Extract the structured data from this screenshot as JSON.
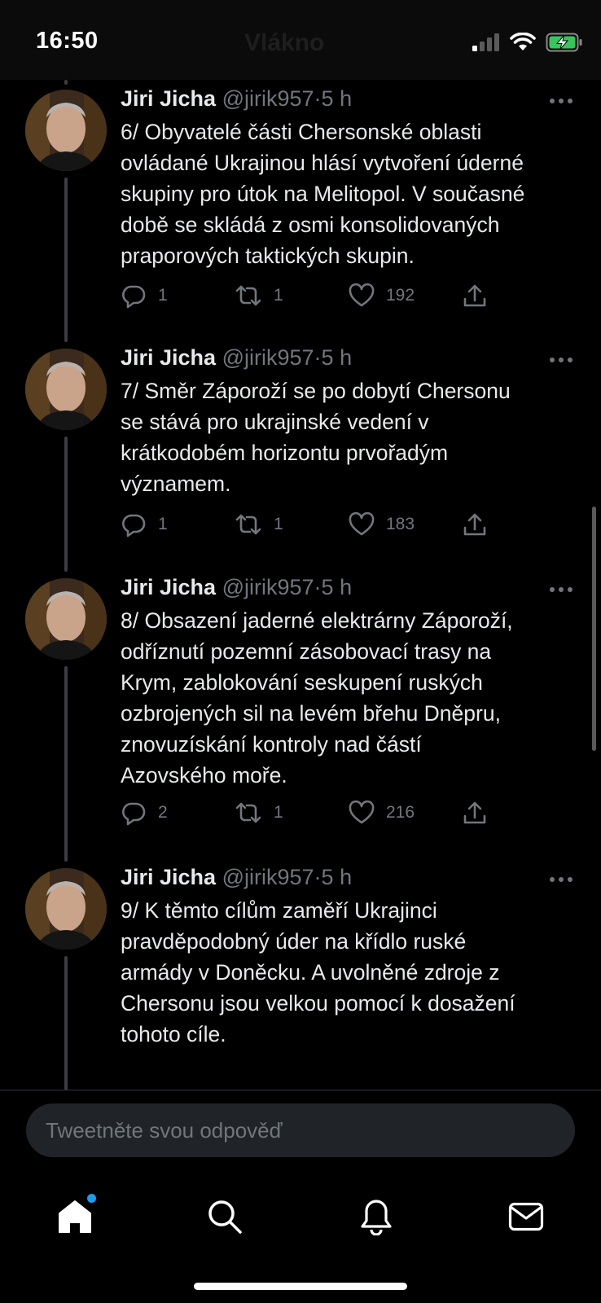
{
  "status": {
    "time": "16:50",
    "faded_title": "Vlákno"
  },
  "author": {
    "name": "Jiri Jicha",
    "handle": "@jirik957",
    "separator": "·"
  },
  "tweets": [
    {
      "time": "5 h",
      "text": "6/ Obyvatelé části Chersonské oblasti\novládané Ukrajinou hlásí vytvoření úderné\nskupiny pro útok na Melitopol. V současné\ndobě se skládá z osmi konsolidovaných\npraporových taktických skupin.",
      "replies": "1",
      "retweets": "1",
      "likes": "192"
    },
    {
      "time": "5 h",
      "text": "7/  Směr Záporoží se po dobytí Chersonu\nse stává pro ukrajinské vedení v\nkrátkodobém horizontu prvořadým\nvýznamem.",
      "replies": "1",
      "retweets": "1",
      "likes": "183"
    },
    {
      "time": "5 h",
      "text": "8/  Obsazení jaderné elektrárny Záporoží,\nodříznutí pozemní zásobovací trasy na\nKrym, zablokování seskupení ruských\nozbrojených sil na levém břehu Dněpru,\nznovuzískání kontroly nad částí\nAzovského moře.",
      "replies": "2",
      "retweets": "1",
      "likes": "216"
    },
    {
      "time": "5 h",
      "text": "9/ K těmto cílům zaměří Ukrajinci\npravděpodobný úder na křídlo ruské\narmády v Doněcku. A uvolněné zdroje z\nChersonu jsou velkou pomocí k dosažení\ntohoto cíle."
    }
  ],
  "reply": {
    "placeholder": "Tweetněte svou odpověď"
  },
  "tabs": [
    {
      "icon": "home-icon"
    },
    {
      "icon": "search-icon"
    },
    {
      "icon": "bell-icon"
    },
    {
      "icon": "mail-icon"
    }
  ],
  "colors": {
    "accent": "#1d9bf0",
    "muted": "#71767b",
    "text": "#e7e9ea",
    "background": "#000000"
  }
}
